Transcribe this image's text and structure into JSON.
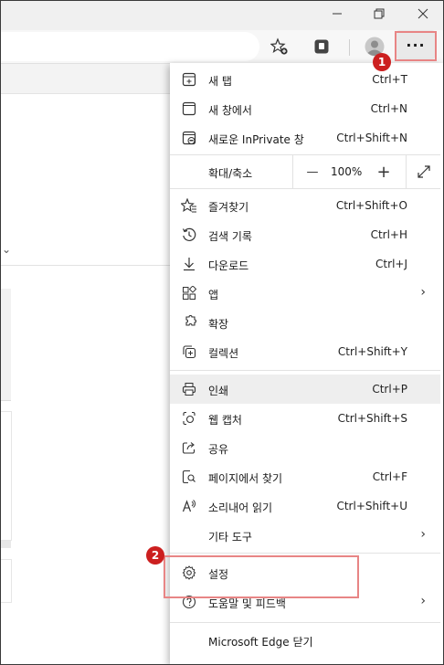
{
  "window": {
    "minimize_icon": "minimize-icon",
    "maximize_icon": "restore-icon",
    "close_icon": "close-icon"
  },
  "toolbar": {
    "favorites_add_icon": "star-plus-icon",
    "collections_icon": "collections-icon",
    "profile_icon": "avatar-icon",
    "more_icon": "ellipsis-icon",
    "more_label": "···"
  },
  "annotations": {
    "step1": "1",
    "step2": "2",
    "highlight_color": "#e88585",
    "badge_color": "#cc1f1f"
  },
  "menu": {
    "items_top": [
      {
        "icon": "new-tab-icon",
        "label": "새 탭",
        "shortcut": "Ctrl+T"
      },
      {
        "icon": "new-window-icon",
        "label": "새 창에서",
        "shortcut": "Ctrl+N"
      },
      {
        "icon": "inprivate-icon",
        "label": "새로운 InPrivate 창",
        "shortcut": "Ctrl+Shift+N"
      }
    ],
    "zoom": {
      "label": "확대/축소",
      "minus": "—",
      "value": "100%",
      "plus": "+",
      "fullscreen_icon": "fullscreen-icon"
    },
    "items_mid": [
      {
        "icon": "favorites-icon",
        "label": "즐겨찾기",
        "shortcut": "Ctrl+Shift+O"
      },
      {
        "icon": "history-icon",
        "label": "검색 기록",
        "shortcut": "Ctrl+H"
      },
      {
        "icon": "download-icon",
        "label": "다운로드",
        "shortcut": "Ctrl+J"
      },
      {
        "icon": "apps-icon",
        "label": "앱",
        "shortcut": "",
        "arrow": "›"
      },
      {
        "icon": "extensions-icon",
        "label": "확장",
        "shortcut": ""
      },
      {
        "icon": "collections-icon",
        "label": "컬렉션",
        "shortcut": "Ctrl+Shift+Y"
      }
    ],
    "items_low": [
      {
        "icon": "print-icon",
        "label": "인쇄",
        "shortcut": "Ctrl+P"
      },
      {
        "icon": "web-capture-icon",
        "label": "웹 캡처",
        "shortcut": "Ctrl+Shift+S"
      },
      {
        "icon": "share-icon",
        "label": "공유",
        "shortcut": ""
      },
      {
        "icon": "find-icon",
        "label": "페이지에서 찾기",
        "shortcut": "Ctrl+F"
      },
      {
        "icon": "read-aloud-icon",
        "label": "소리내어 읽기",
        "shortcut": "Ctrl+Shift+U"
      },
      {
        "icon": "",
        "label": "기타 도구",
        "shortcut": "",
        "arrow": "›"
      }
    ],
    "items_bottom": [
      {
        "icon": "gear-icon",
        "label": "설정",
        "shortcut": ""
      },
      {
        "icon": "help-icon",
        "label": "도움말 및 피드백",
        "shortcut": "",
        "arrow": "›"
      }
    ],
    "close": {
      "label": "Microsoft Edge 닫기"
    }
  },
  "page": {
    "chevron": "⌄"
  }
}
